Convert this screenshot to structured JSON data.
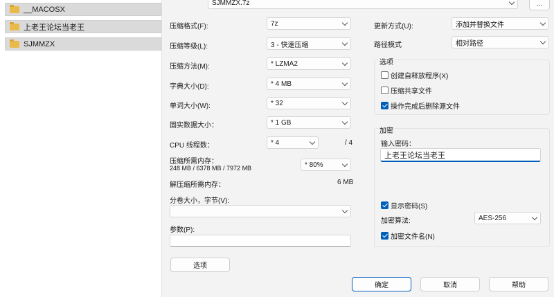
{
  "explorer": {
    "folders": [
      "__MACOSX",
      "上老王论坛当老王",
      "SJMMZX"
    ]
  },
  "archive": {
    "name": "SJMMZX.7z",
    "browse_label": "..."
  },
  "left": {
    "format_label": "压缩格式(F):",
    "format_value": "7z",
    "level_label": "压缩等级(L):",
    "level_value": "3 - 快速压缩",
    "method_label": "压缩方法(M):",
    "method_value": "* LZMA2",
    "dict_label": "字典大小(D):",
    "dict_value": "* 4 MB",
    "word_label": "单词大小(W):",
    "word_value": "* 32",
    "solid_label": "固实数据大小：",
    "solid_value": "* 1 GB",
    "cpu_label": "CPU 线程数：",
    "cpu_value": "* 4",
    "cpu_total": "/ 4",
    "mem_label": "压缩所需内存：",
    "mem_info": "248 MB / 6378 MB / 7972 MB",
    "mem_value": "* 80%",
    "decomp_label": "解压缩所需内存：",
    "decomp_value": "6 MB",
    "split_label": "分卷大小，字节(V):",
    "split_value": "",
    "params_label": "参数(P):",
    "params_value": "",
    "options_button": "选项"
  },
  "right": {
    "update_label": "更新方式(U):",
    "update_value": "添加并替换文件",
    "path_label": "路径模式",
    "path_value": "相对路径",
    "options_title": "选项",
    "opt_sfx": "创建自释放程序(X)",
    "opt_shared": "压缩共享文件",
    "opt_delete": "操作完成后删除源文件",
    "opt_delete_checked": true,
    "enc_title": "加密",
    "pwd_label": "输入密码：",
    "pwd_value": "上老王论坛当老王",
    "show_pwd": "显示密码(S)",
    "enc_method_label": "加密算法:",
    "enc_method_value": "AES-256",
    "enc_names": "加密文件名(N)"
  },
  "footer": {
    "ok": "确定",
    "cancel": "取消",
    "help": "帮助"
  },
  "colors": {
    "accent": "#005fb8",
    "dialog_bg": "#f3f3f3",
    "folder": "#e9b94a"
  }
}
